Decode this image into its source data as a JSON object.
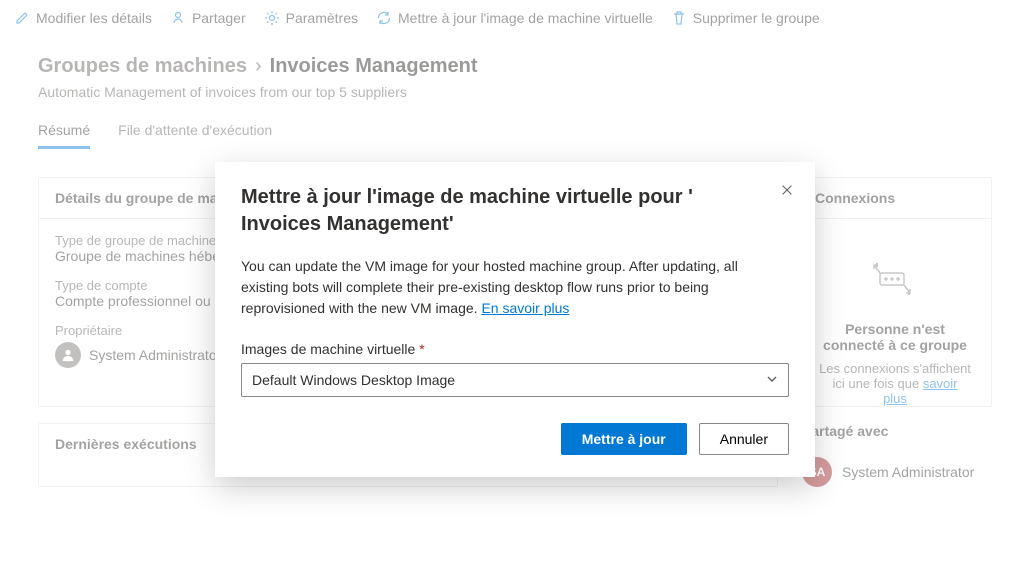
{
  "toolbar": {
    "edit": "Modifier les détails",
    "share": "Partager",
    "settings": "Paramètres",
    "updateVm": "Mettre à jour l'image de machine virtuelle",
    "delete": "Supprimer le groupe"
  },
  "breadcrumb": {
    "parent": "Groupes de machines",
    "current": "Invoices Management",
    "description": "Automatic Management of invoices from our top 5 suppliers"
  },
  "tabs": {
    "summary": "Résumé",
    "queue": "File d'attente d'exécution"
  },
  "details": {
    "panelTitle": "Détails du groupe de machines",
    "groupTypeLabel": "Type de groupe de machines",
    "groupTypeValue": "Groupe de machines hébergées",
    "acctTypeLabel": "Type de compte",
    "acctTypeValue": "Compte professionnel ou scolaire",
    "ownerLabel": "Propriétaire",
    "ownerValue": "System Administrator"
  },
  "connections": {
    "panelTitle": "Connexions",
    "empty": "Personne n'est connecté à ce groupe",
    "sub": "Les connexions s'affichent ici une fois que",
    "link": "savoir plus"
  },
  "lastRuns": {
    "title": "Dernières exécutions"
  },
  "shared": {
    "title": "Partagé avec",
    "initials": "SA",
    "name": "System Administrator"
  },
  "dialog": {
    "title": "Mettre à jour l'image de machine virtuelle pour ' Invoices Management'",
    "body": "You can update the VM image for your hosted machine group. After updating, all existing bots will complete their pre-existing desktop flow runs prior to being reprovisioned with the new VM image.",
    "learnMore": "En savoir plus",
    "fieldLabel": "Images de machine virtuelle",
    "selected": "Default Windows Desktop Image",
    "primary": "Mettre à jour",
    "secondary": "Annuler"
  }
}
